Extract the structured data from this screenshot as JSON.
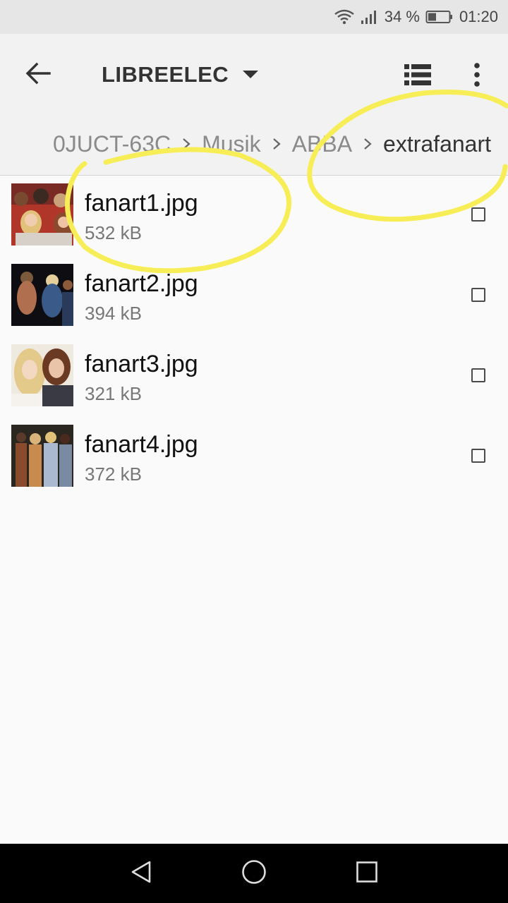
{
  "status_bar": {
    "battery_percent": "34 %",
    "time": "01:20",
    "icons": [
      "wifi-icon",
      "signal-icon",
      "battery-icon"
    ]
  },
  "app_bar": {
    "title": "LIBREELEC",
    "icons": [
      "back-arrow-icon",
      "dropdown-caret-icon",
      "list-view-icon",
      "more-vert-icon"
    ]
  },
  "breadcrumb": {
    "items": [
      "0JUCT-63C",
      "Musik",
      "ABBA",
      "extrafanart"
    ]
  },
  "files": [
    {
      "name": "fanart1.jpg",
      "size": "532 kB",
      "checked": false
    },
    {
      "name": "fanart2.jpg",
      "size": "394 kB",
      "checked": false
    },
    {
      "name": "fanart3.jpg",
      "size": "321 kB",
      "checked": false
    },
    {
      "name": "fanart4.jpg",
      "size": "372 kB",
      "checked": false
    }
  ],
  "nav_bar": {
    "icons": [
      "nav-back-icon",
      "nav-home-icon",
      "nav-recents-icon"
    ]
  },
  "colors": {
    "highlight": "#f7ee57",
    "status_bar_bg": "#e6e6e6",
    "app_bar_bg": "#f2f2f2",
    "page_bg": "#fafafa",
    "nav_bar_bg": "#000000"
  }
}
